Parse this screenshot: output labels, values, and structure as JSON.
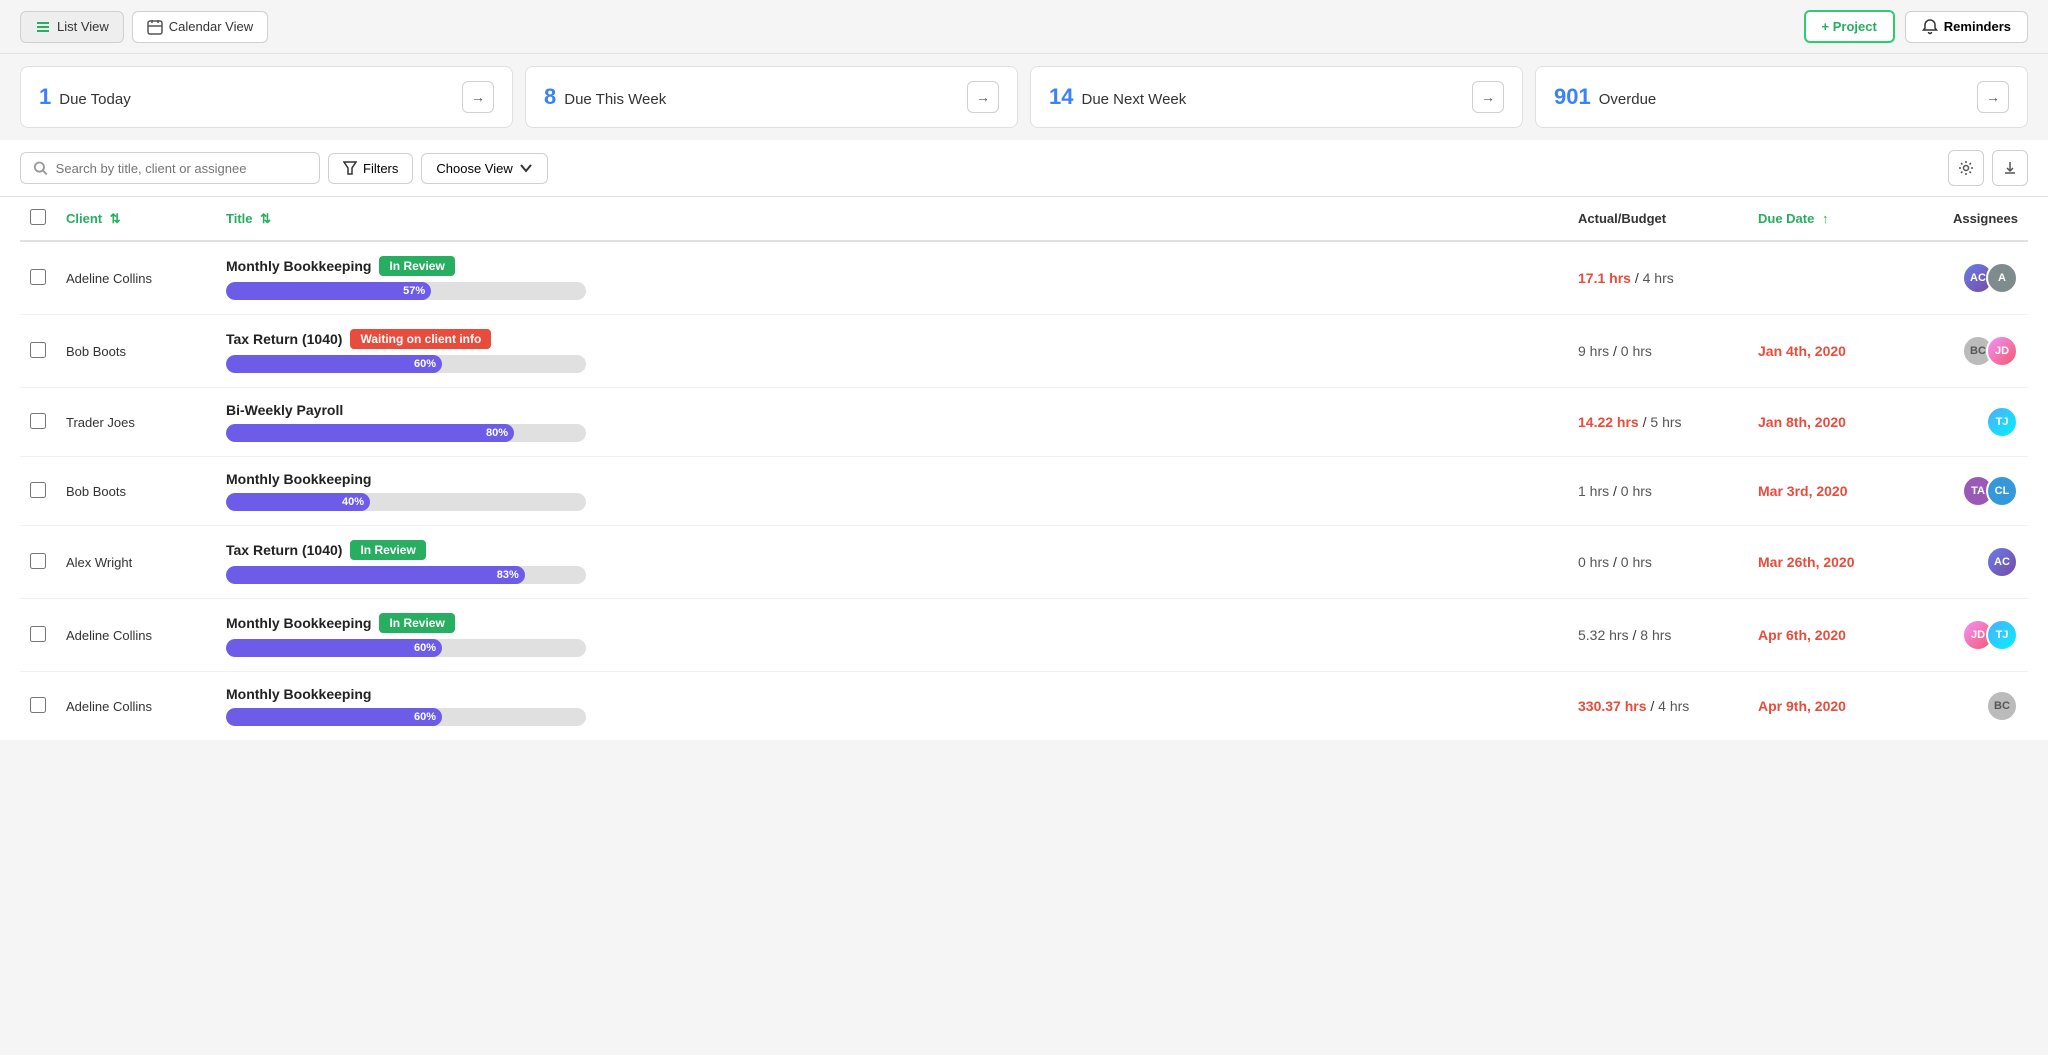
{
  "topBar": {
    "listViewLabel": "List View",
    "calendarViewLabel": "Calendar View",
    "projectBtnLabel": "+ Project",
    "remindersBtnLabel": "Reminders"
  },
  "summaryCards": [
    {
      "num": "1",
      "label": "Due Today"
    },
    {
      "num": "8",
      "label": "Due This Week"
    },
    {
      "num": "14",
      "label": "Due Next Week"
    },
    {
      "num": "901",
      "label": "Overdue"
    }
  ],
  "toolbar": {
    "searchPlaceholder": "Search by title, client or assignee",
    "filterLabel": "Filters",
    "chooseViewLabel": "Choose View"
  },
  "table": {
    "columns": [
      "Client",
      "Title",
      "Actual/Budget",
      "Due Date",
      "Assignees"
    ],
    "rows": [
      {
        "client": "Adeline Collins",
        "title": "Monthly Bookkeeping",
        "badge": "In Review",
        "badgeType": "green",
        "progress": 57,
        "actual": "17.1 hrs",
        "budget": "4 hrs",
        "actualOver": true,
        "dueDate": "",
        "dueDateOver": false,
        "assignees": [
          "photo1",
          "A"
        ]
      },
      {
        "client": "Bob Boots",
        "title": "Tax Return (1040)",
        "badge": "Waiting on client info",
        "badgeType": "red",
        "progress": 60,
        "actual": "9 hrs",
        "budget": "0 hrs",
        "actualOver": false,
        "dueDate": "Jan 4th, 2020",
        "dueDateOver": true,
        "assignees": [
          "BC",
          "photo2"
        ]
      },
      {
        "client": "Trader Joes",
        "title": "Bi-Weekly Payroll",
        "badge": "",
        "badgeType": "",
        "progress": 80,
        "actual": "14.22 hrs",
        "budget": "5 hrs",
        "actualOver": true,
        "dueDate": "Jan 8th, 2020",
        "dueDateOver": true,
        "assignees": [
          "photo3"
        ]
      },
      {
        "client": "Bob Boots",
        "title": "Monthly Bookkeeping",
        "badge": "",
        "badgeType": "",
        "progress": 40,
        "actual": "1 hrs",
        "budget": "0 hrs",
        "actualOver": false,
        "dueDate": "Mar 3rd, 2020",
        "dueDateOver": true,
        "assignees": [
          "TA",
          "CL"
        ]
      },
      {
        "client": "Alex Wright",
        "title": "Tax Return (1040)",
        "badge": "In Review",
        "badgeType": "green",
        "progress": 83,
        "actual": "0 hrs",
        "budget": "0 hrs",
        "actualOver": false,
        "dueDate": "Mar 26th, 2020",
        "dueDateOver": true,
        "assignees": [
          "photo1"
        ]
      },
      {
        "client": "Adeline Collins",
        "title": "Monthly Bookkeeping",
        "badge": "In Review",
        "badgeType": "green",
        "progress": 60,
        "actual": "5.32 hrs",
        "budget": "8 hrs",
        "actualOver": false,
        "dueDate": "Apr 6th, 2020",
        "dueDateOver": true,
        "assignees": [
          "photo2",
          "photo3"
        ]
      },
      {
        "client": "Adeline Collins",
        "title": "Monthly Bookkeeping",
        "badge": "",
        "badgeType": "",
        "progress": 60,
        "actual": "330.37 hrs",
        "budget": "4 hrs",
        "actualOver": true,
        "dueDate": "Apr 9th, 2020",
        "dueDateOver": true,
        "assignees": [
          "BC"
        ]
      }
    ]
  }
}
